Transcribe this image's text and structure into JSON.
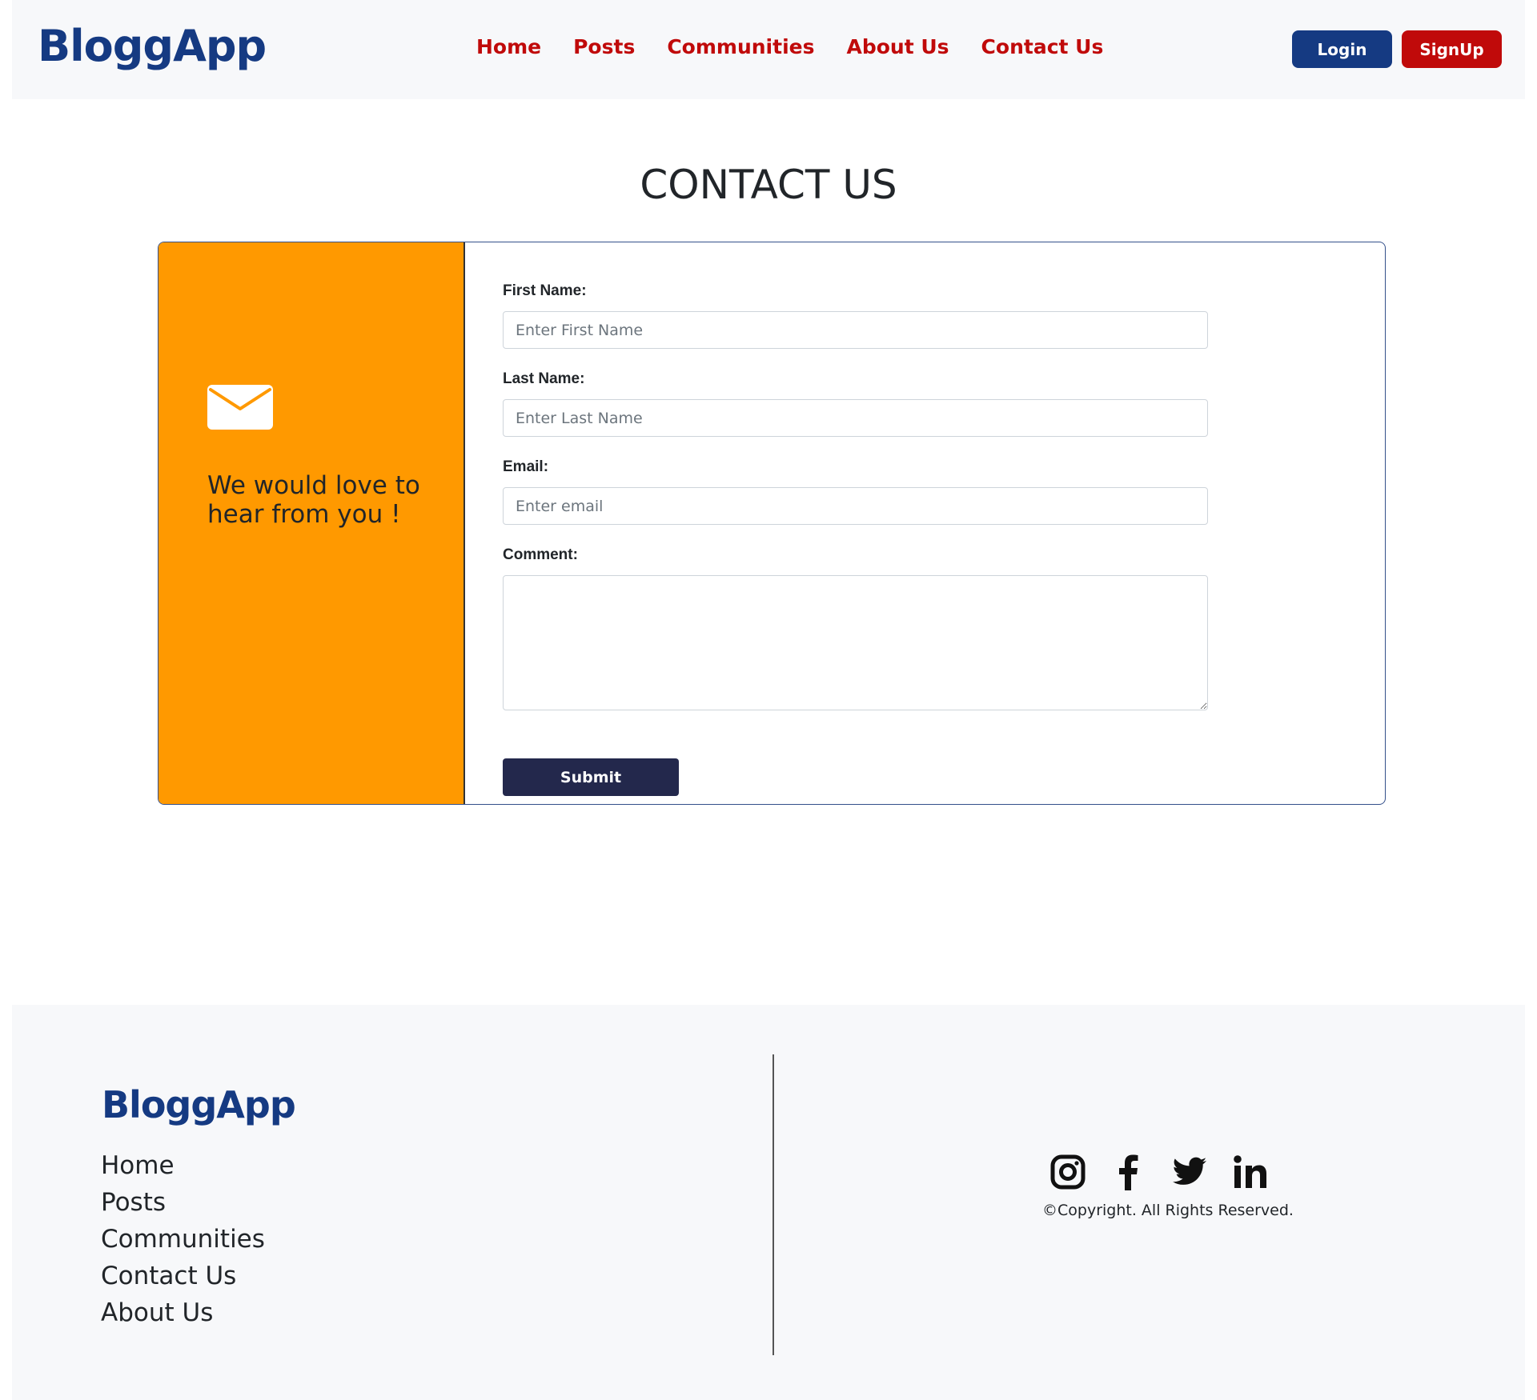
{
  "header": {
    "brand": "BloggApp",
    "nav": [
      "Home",
      "Posts",
      "Communities",
      "About Us",
      "Contact Us"
    ],
    "login": "Login",
    "signup": "SignUp"
  },
  "page": {
    "title": "CONTACT US"
  },
  "card": {
    "tagline": "We would love to hear from you !",
    "form": {
      "first_name_label": "First Name:",
      "first_name_placeholder": "Enter First Name",
      "last_name_label": "Last Name:",
      "last_name_placeholder": "Enter Last Name",
      "email_label": "Email:",
      "email_placeholder": "Enter email",
      "comment_label": "Comment:",
      "submit": "Submit"
    }
  },
  "footer": {
    "brand": "BloggApp",
    "links": [
      "Home",
      "Posts",
      "Communities",
      "Contact Us",
      "About Us"
    ],
    "socials": [
      "instagram-icon",
      "facebook-icon",
      "twitter-icon",
      "linkedin-icon"
    ],
    "copyright": "©Copyright. All Rights Reserved."
  },
  "colors": {
    "brand_blue": "#153a82",
    "accent_red": "#c00a0a",
    "orange": "#ff9900",
    "submit_bg": "#23284c"
  }
}
